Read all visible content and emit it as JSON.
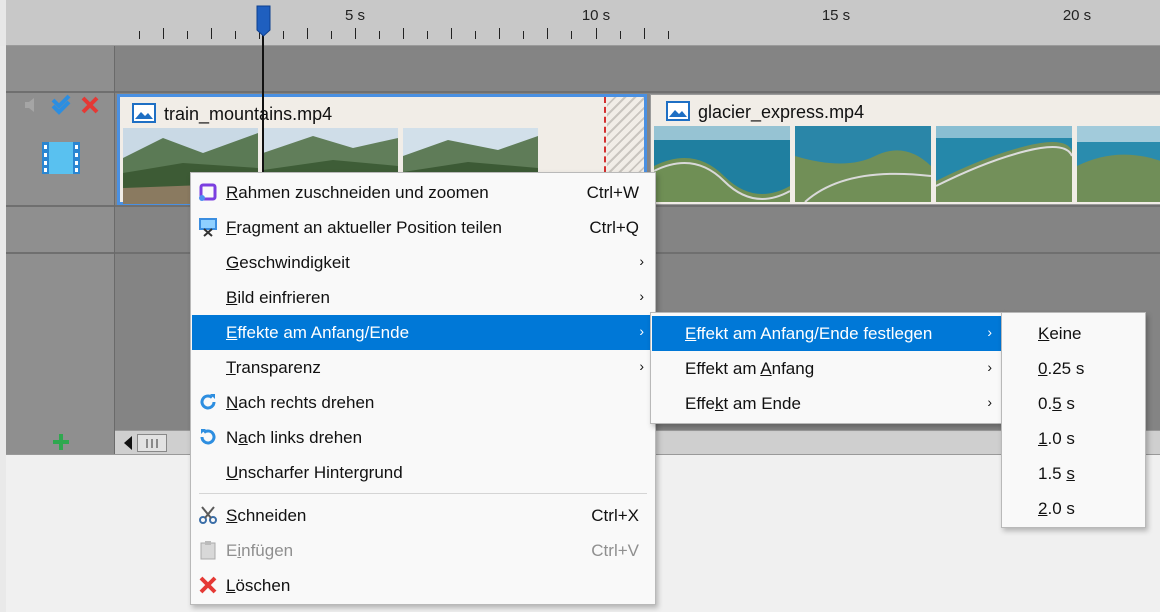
{
  "ruler": {
    "labels": [
      {
        "text": "5 s"
      },
      {
        "text": "10 s"
      },
      {
        "text": "15 s"
      },
      {
        "text": "20 s"
      }
    ]
  },
  "clips": [
    {
      "title": "train_mountains.mp4"
    },
    {
      "title": "glacier_express.mp4"
    }
  ],
  "context_menu": {
    "items": [
      {
        "u": "R",
        "rest": "ahmen zuschneiden und zoomen",
        "shortcut": "Ctrl+W",
        "icon": "crop-zoom-icon"
      },
      {
        "u": "F",
        "rest": "ragment an aktueller Position teilen",
        "shortcut": "Ctrl+Q",
        "icon": "split-icon"
      },
      {
        "u": "G",
        "rest": "eschwindigkeit",
        "submenu": "›"
      },
      {
        "u": "B",
        "rest": "ild einfrieren",
        "submenu": "›"
      },
      {
        "u": "E",
        "rest": "ffekte am Anfang/Ende",
        "submenu": "›"
      },
      {
        "u": "T",
        "rest": "ransparenz",
        "submenu": "›"
      },
      {
        "u": "N",
        "rest": "ach rechts drehen",
        "icon": "rotate-right-icon"
      },
      {
        "pre": "N",
        "u": "a",
        "rest": "ch links drehen",
        "icon": "rotate-left-icon"
      },
      {
        "u": "U",
        "rest": "nscharfer Hintergrund"
      },
      {
        "u": "S",
        "rest": "chneiden",
        "shortcut": "Ctrl+X",
        "icon": "scissors-icon"
      },
      {
        "pre": "E",
        "u": "i",
        "rest": "nfügen",
        "shortcut": "Ctrl+V",
        "icon": "paste-icon",
        "disabled": true
      },
      {
        "u": "L",
        "rest": "öschen",
        "icon": "delete-icon"
      }
    ]
  },
  "submenu_effects": {
    "items": [
      {
        "u": "E",
        "rest": "ffekt am Anfang/Ende festlegen",
        "submenu": "›"
      },
      {
        "pre": "Effekt am ",
        "u": "A",
        "rest": "nfang",
        "submenu": "›"
      },
      {
        "pre": "Effe",
        "u": "k",
        "rest": "t am Ende",
        "submenu": "›"
      }
    ]
  },
  "submenu_durations": {
    "items": [
      {
        "u": "K",
        "rest": "eine"
      },
      {
        "u": "0",
        "rest": ".25 s"
      },
      {
        "pre": "0.",
        "u": "5",
        "rest": " s"
      },
      {
        "u": "1",
        "rest": ".0 s"
      },
      {
        "pre": "1.5 ",
        "u": "s",
        "rest": ""
      },
      {
        "u": "2",
        "rest": ".0 s"
      }
    ]
  },
  "colors": {
    "highlight": "#0078d7",
    "playhead": "#1f5fbf",
    "clip_border_selected": "#4a90e2",
    "delete_red": "#e53935",
    "add_green": "#2fa84f"
  }
}
